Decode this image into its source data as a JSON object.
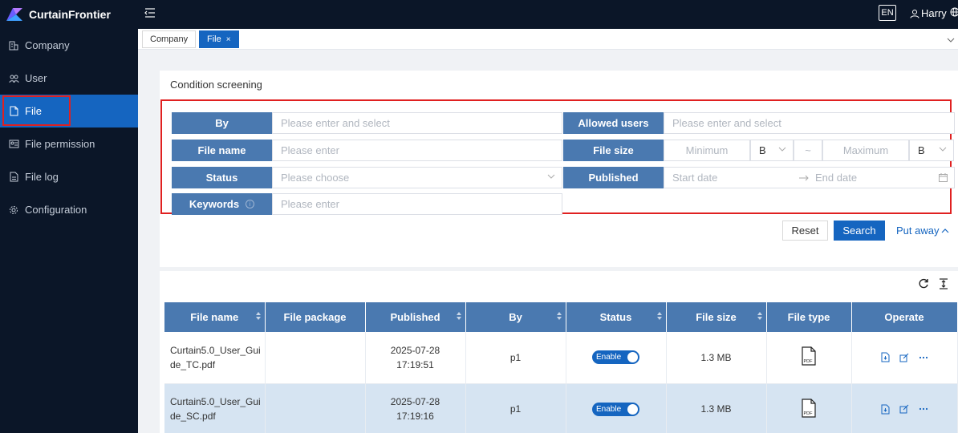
{
  "app": {
    "name": "CurtainFrontier"
  },
  "sidebar": {
    "items": [
      {
        "label": "Company",
        "icon": "building-icon"
      },
      {
        "label": "User",
        "icon": "users-icon"
      },
      {
        "label": "File",
        "icon": "file-icon",
        "active": true
      },
      {
        "label": "File permission",
        "icon": "id-card-icon"
      },
      {
        "label": "File log",
        "icon": "log-icon"
      },
      {
        "label": "Configuration",
        "icon": "gear-icon"
      }
    ]
  },
  "topbar": {
    "lang": "EN",
    "user": "Harry"
  },
  "tabs": [
    {
      "label": "Company"
    },
    {
      "label": "File",
      "close": "×"
    }
  ],
  "filter": {
    "title": "Condition screening",
    "by": {
      "label": "By",
      "placeholder": "Please enter and select"
    },
    "allowed_users": {
      "label": "Allowed users",
      "placeholder": "Please enter and select"
    },
    "file_name": {
      "label": "File name",
      "placeholder": "Please enter"
    },
    "file_size": {
      "label": "File size",
      "min_placeholder": "Minimum",
      "max_placeholder": "Maximum",
      "unit_min": "B",
      "unit_max": "B",
      "separator": "~"
    },
    "status": {
      "label": "Status",
      "placeholder": "Please choose"
    },
    "published": {
      "label": "Published",
      "start_placeholder": "Start date",
      "end_placeholder": "End date"
    },
    "keywords": {
      "label": "Keywords",
      "placeholder": "Please enter"
    },
    "reset": "Reset",
    "search": "Search",
    "put_away": "Put away"
  },
  "table": {
    "headers": [
      "File name",
      "File package",
      "Published",
      "By",
      "Status",
      "File size",
      "File type",
      "Operate"
    ],
    "rows": [
      {
        "file_name": "Curtain5.0_User_Guide_TC.pdf",
        "file_package": "",
        "published_date": "2025-07-28",
        "published_time": "17:19:51",
        "by": "p1",
        "status": "Enable",
        "size": "1.3 MB",
        "type_badge": "PDF"
      },
      {
        "file_name": "Curtain5.0_User_Guide_SC.pdf",
        "file_package": "",
        "published_date": "2025-07-28",
        "published_time": "17:19:16",
        "by": "p1",
        "status": "Enable",
        "size": "1.3 MB",
        "type_badge": "PDF"
      }
    ]
  },
  "colors": {
    "primary": "#1565c0",
    "header": "#4a79b0",
    "sidebar_bg": "#0b1628",
    "highlight": "#e02020"
  }
}
